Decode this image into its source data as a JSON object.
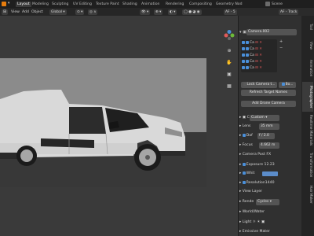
{
  "topbar": {
    "tabs": [
      "Layout",
      "Modeling",
      "Sculpting",
      "UV Editing",
      "Texture Paint",
      "Shading",
      "Animation",
      "Rendering",
      "Compositing",
      "Geometry Nod"
    ],
    "active_tab": "Layout",
    "scene": "Scene"
  },
  "menubar": {
    "items": [
      "View",
      "Add",
      "Object"
    ],
    "orientation": "Global",
    "overlay_label": "AF - Track",
    "af_label": "AF - 5",
    "options_label": "Options"
  },
  "panel": {
    "camera_name": "Camera.002",
    "list_items": [
      {
        "label": "Ca",
        "checked": true
      },
      {
        "label": "Ca",
        "checked": true
      },
      {
        "label": "Ca",
        "checked": true
      },
      {
        "label": "Ca",
        "checked": true
      },
      {
        "label": "Ca",
        "checked": true
      }
    ],
    "lock_camera_label": "Lock Camera t...",
    "bool_label": "Bo...",
    "refresh_label": "Refresh Target Names",
    "add_drone_label": "Add Drone Camera",
    "camera_label": "Ca",
    "camera_type": "Custom",
    "lens_label": "Lens",
    "lens_value": "35 mm",
    "dof_label": "Dof",
    "dof_value": "f / 2.0",
    "focus_label": "Focus",
    "focus_value": "4.662 m",
    "post_fx_label": "Camera Post FX",
    "exposure_label": "Exposure",
    "exposure_value": "12.23",
    "white_label": "Whit",
    "resolution_label": "Resolution",
    "resolution_value": "1440",
    "view_label": "View Layer",
    "render_label": "Rende",
    "render_engine": "Cycles",
    "world_label": "World/Water",
    "light_label": "Light",
    "emissive_label": "Emissive Mater"
  },
  "sidetabs": [
    "Tool",
    "View",
    "Animation",
    "Photographer",
    "Realtime Materials",
    "Transformation",
    "Hair Maker"
  ],
  "colors": {
    "accent": "#4a8fd9",
    "panel_bg": "#303030",
    "viewport_bg": "#3a3a3a",
    "topbar_bg": "#1f1f1f"
  }
}
